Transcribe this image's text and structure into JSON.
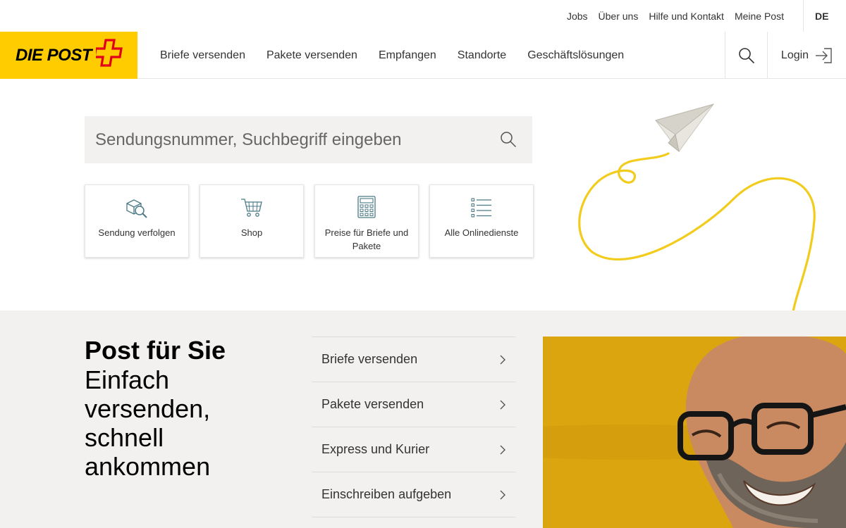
{
  "topbar": {
    "links": [
      "Jobs",
      "Über uns",
      "Hilfe und Kontakt",
      "Meine Post"
    ],
    "language": "DE"
  },
  "header": {
    "logo_text": "DIE POST",
    "nav": [
      "Briefe versenden",
      "Pakete versenden",
      "Empfangen",
      "Standorte",
      "Geschäftslösungen"
    ],
    "login_label": "Login"
  },
  "hero": {
    "search_placeholder": "Sendungsnummer, Suchbegriff eingeben",
    "tiles": [
      {
        "label": "Sendung verfolgen",
        "icon": "package-track-icon"
      },
      {
        "label": "Shop",
        "icon": "cart-icon"
      },
      {
        "label": "Preise für Briefe und Pakete",
        "icon": "calculator-icon"
      },
      {
        "label": "Alle Onlinedienste",
        "icon": "list-icon"
      }
    ]
  },
  "section": {
    "title_strong": "Post für Sie",
    "title_light": "Einfach versenden, schnell ankommen",
    "links": [
      "Briefe versenden",
      "Pakete versenden",
      "Express und Kurier",
      "Einschreiben aufgeben"
    ]
  },
  "colors": {
    "brand_yellow": "#ffcc00",
    "brand_red": "#e2001a",
    "icon_teal": "#4a7a85",
    "section_bg": "#f2f1ef"
  }
}
